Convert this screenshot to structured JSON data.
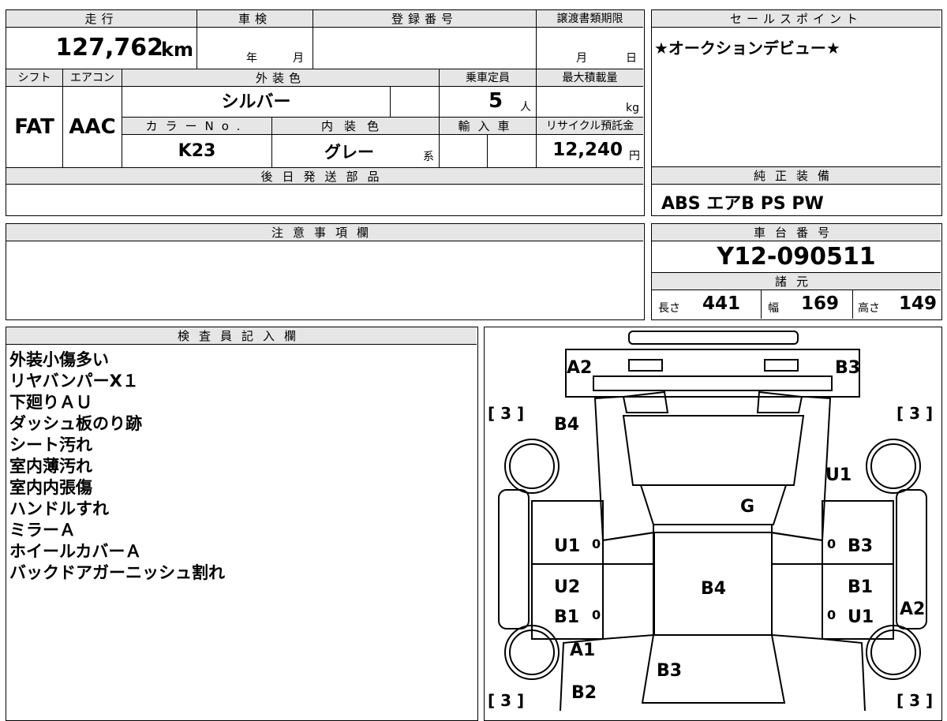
{
  "header": {
    "mileage_label": "走行",
    "inspection_label": "車検",
    "registration_label": "登録番号",
    "transfer_deadline_label": "譲渡書類期限",
    "sales_point_label": "セールスポイント",
    "shift_label": "シフト",
    "ac_label": "エアコン",
    "exterior_color_label": "外装色",
    "capacity_label": "乗車定員",
    "max_load_label": "最大積載量",
    "color_no_label": "カラーNo.",
    "interior_color_label": "内装色",
    "import_label": "輸入車",
    "recycle_label": "リサイクル預託金",
    "later_parts_label": "後日発送部品",
    "std_equipment_label": "純正装備",
    "notes_label": "注意事項欄",
    "chassis_label": "車台番号",
    "specs_label": "諸元",
    "inspector_label": "検査員記入欄"
  },
  "values": {
    "mileage": "127,762",
    "mileage_unit": "km",
    "year_unit": "年",
    "month_unit": "月",
    "day_unit": "日",
    "shift": "FAT",
    "ac": "AAC",
    "exterior_color": "シルバー",
    "capacity": "5",
    "capacity_unit": "人",
    "load_unit": "kg",
    "color_no": "K23",
    "interior_color": "グレー",
    "interior_suffix": "系",
    "recycle_fee": "12,240",
    "yen_unit": "円",
    "sales_point": "★オークションデビュー★",
    "std_equipment": "ABS エアB PS PW",
    "chassis_no": "Y12-090511",
    "length_label": "長さ",
    "length": "441",
    "width_label": "幅",
    "width": "169",
    "height_label": "高さ",
    "height": "149"
  },
  "inspector_notes": [
    "外装小傷多い",
    "リヤバンパーX１",
    "下廻りＡＵ",
    "ダッシュ板のり跡",
    "シート汚れ",
    "室内薄汚れ",
    "室内内張傷",
    "ハンドルすれ",
    "ミラーＡ",
    "ホイールカバーＡ",
    "バックドアガーニッシュ割れ"
  ],
  "diagram": {
    "A2_tl": "A2",
    "B3_tr": "B3",
    "B4_top": "B4",
    "U1_right": "U1",
    "G": "G",
    "U1_left": "U1",
    "zero_1": "0",
    "zero_2": "0",
    "B3_right": "B3",
    "U2": "U2",
    "B4_center": "B4",
    "B1_right": "B1",
    "B1_left": "B1",
    "zero_3": "0",
    "zero_4": "0",
    "U1_right2": "U1",
    "A2_right": "A2",
    "A1": "A1",
    "B3_bottom": "B3",
    "B2": "B2",
    "bracket_tl": "[ 3 ]",
    "bracket_tr": "[ 3 ]",
    "bracket_bl": "[ 3 ]",
    "bracket_br": "[ 3 ]"
  }
}
